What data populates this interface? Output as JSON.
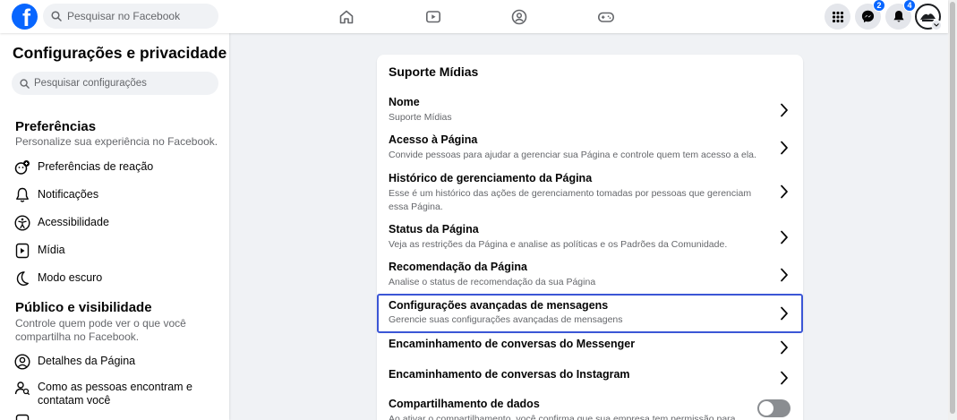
{
  "topbar": {
    "logo_letter": "f",
    "search_placeholder": "Pesquisar no Facebook",
    "nav_icons": [
      "home-icon",
      "watch-icon",
      "groups-icon",
      "gaming-icon"
    ],
    "menu_icon": "grid-menu-icon",
    "messenger_badge": "2",
    "notifications_badge": "4",
    "brand_color": "#0866ff"
  },
  "sidebar": {
    "title": "Configurações e privacidade",
    "search_placeholder": "Pesquisar configurações",
    "sections": [
      {
        "title": "Preferências",
        "description": "Personalize sua experiência no Facebook.",
        "items": [
          {
            "label": "Preferências de reação",
            "icon": "reaction-icon"
          },
          {
            "label": "Notificações",
            "icon": "bell-icon"
          },
          {
            "label": "Acessibilidade",
            "icon": "accessibility-icon"
          },
          {
            "label": "Mídia",
            "icon": "media-icon"
          },
          {
            "label": "Modo escuro",
            "icon": "moon-icon"
          }
        ]
      },
      {
        "title": "Público e visibilidade",
        "description": "Controle quem pode ver o que você compartilha no Facebook.",
        "items": [
          {
            "label": "Detalhes da Página",
            "icon": "profile-icon"
          },
          {
            "label": "Como as pessoas encontram e contatam você",
            "icon": "find-people-icon"
          }
        ]
      }
    ]
  },
  "card": {
    "title": "Suporte Mídias",
    "rows": [
      {
        "title": "Nome",
        "description": "Suporte Mídias"
      },
      {
        "title": "Acesso à Página",
        "description": "Convide pessoas para ajudar a gerenciar sua Página e controle quem tem acesso a ela."
      },
      {
        "title": "Histórico de gerenciamento da Página",
        "description": "Esse é um histórico das ações de gerenciamento tomadas por pessoas que gerenciam essa Página."
      },
      {
        "title": "Status da Página",
        "description": "Veja as restrições da Página e analise as políticas e os Padrões da Comunidade."
      },
      {
        "title": "Recomendação da Página",
        "description": "Analise o status de recomendação da sua Página"
      },
      {
        "title": "Configurações avançadas de mensagens",
        "description": "Gerencie suas configurações avançadas de mensagens"
      },
      {
        "title": "Encaminhamento de conversas do Messenger",
        "description": ""
      },
      {
        "title": "Encaminhamento de conversas do Instagram",
        "description": ""
      },
      {
        "title": "Compartilhamento de dados",
        "description": "Ao ativar o compartilhamento, você confirma que sua empresa tem permissão para"
      }
    ],
    "data_sharing_enabled": false,
    "highlight_color": "#3b56d6"
  }
}
